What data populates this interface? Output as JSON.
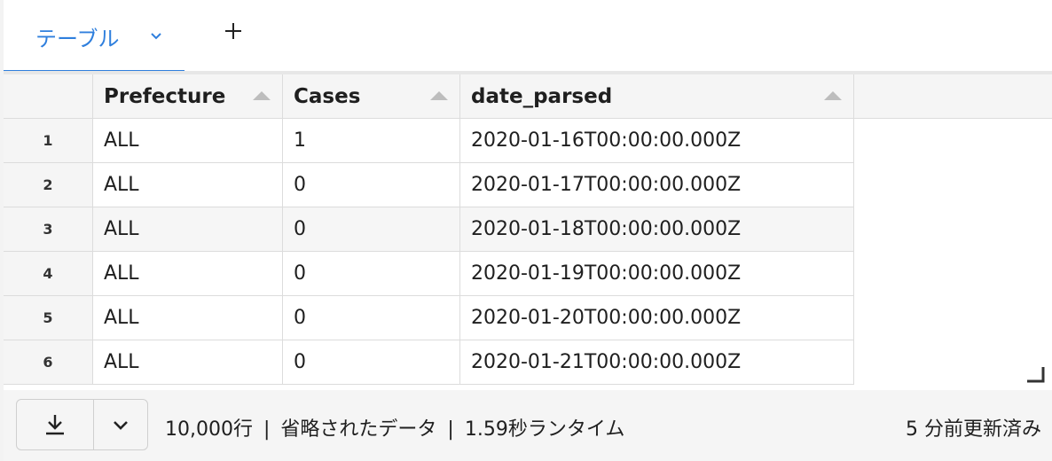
{
  "tabs": [
    {
      "label": "テーブル",
      "active": true
    }
  ],
  "table": {
    "columns": [
      {
        "label": "Prefecture"
      },
      {
        "label": "Cases"
      },
      {
        "label": "date_parsed"
      }
    ],
    "rows": [
      {
        "index": "1",
        "prefecture": "ALL",
        "cases": "1",
        "date": "2020-01-16T00:00:00.000Z"
      },
      {
        "index": "2",
        "prefecture": "ALL",
        "cases": "0",
        "date": "2020-01-17T00:00:00.000Z"
      },
      {
        "index": "3",
        "prefecture": "ALL",
        "cases": "0",
        "date": "2020-01-18T00:00:00.000Z"
      },
      {
        "index": "4",
        "prefecture": "ALL",
        "cases": "0",
        "date": "2020-01-19T00:00:00.000Z"
      },
      {
        "index": "5",
        "prefecture": "ALL",
        "cases": "0",
        "date": "2020-01-20T00:00:00.000Z"
      },
      {
        "index": "6",
        "prefecture": "ALL",
        "cases": "0",
        "date": "2020-01-21T00:00:00.000Z"
      }
    ]
  },
  "footer": {
    "row_count": "10,000行",
    "separator": "|",
    "truncated": "省略されたデータ",
    "runtime": "1.59秒ランタイム",
    "refreshed": "5 分前更新済み"
  },
  "icons": {
    "tab_dropdown": "chevron-down-icon",
    "add_tab": "plus-icon",
    "sort": "sort-ascending-icon",
    "download": "download-icon",
    "more": "chevron-down-icon",
    "resize": "resize-handle-icon"
  },
  "colors": {
    "accent": "#2f7fdd",
    "header_bg": "#f5f5f5"
  }
}
